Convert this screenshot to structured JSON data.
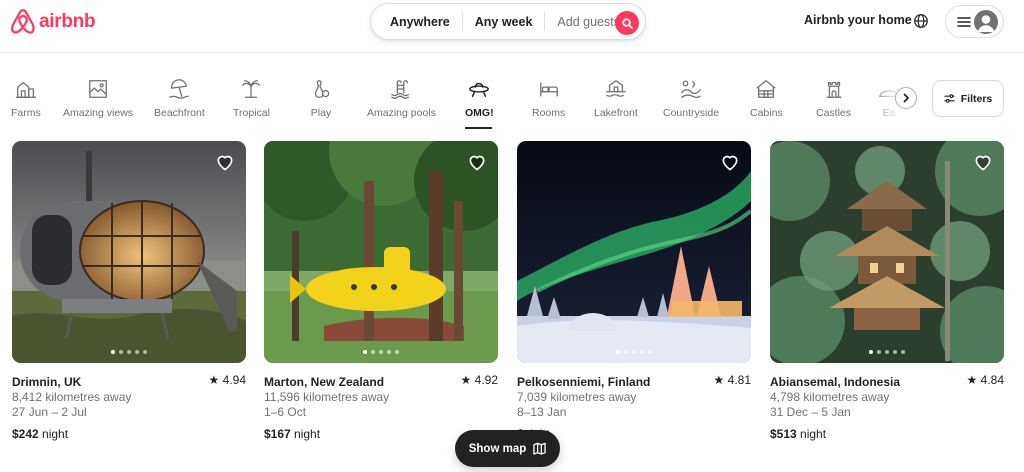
{
  "header": {
    "logo_text": "airbnb",
    "search": {
      "location": "Anywhere",
      "dates": "Any week",
      "guests": "Add guests"
    },
    "host_link": "Airbnb your home",
    "brand_color": "#ff385c"
  },
  "categories": {
    "active": "OMG!",
    "items": [
      {
        "label": "Farms",
        "icon": "barn-icon"
      },
      {
        "label": "Amazing views",
        "icon": "framed-landscape-icon"
      },
      {
        "label": "Beachfront",
        "icon": "beach-umbrella-icon"
      },
      {
        "label": "Tropical",
        "icon": "palm-tree-icon"
      },
      {
        "label": "Play",
        "icon": "bowling-pins-icon"
      },
      {
        "label": "Amazing pools",
        "icon": "pool-ladder-icon"
      },
      {
        "label": "OMG!",
        "icon": "ufo-icon"
      },
      {
        "label": "Rooms",
        "icon": "bed-icon"
      },
      {
        "label": "Lakefront",
        "icon": "lake-house-icon"
      },
      {
        "label": "Countryside",
        "icon": "hills-icon"
      },
      {
        "label": "Cabins",
        "icon": "cabin-icon"
      },
      {
        "label": "Castles",
        "icon": "castle-icon"
      },
      {
        "label": "Ea",
        "icon": "earth-home-icon"
      }
    ],
    "filters_label": "Filters"
  },
  "listings": [
    {
      "location": "Drimnin, UK",
      "rating": "4.94",
      "distance": "8,412 kilometres away",
      "dates": "27 Jun – 2 Jul",
      "price": "$242",
      "price_unit": " night",
      "photo": "glass-dome-pod"
    },
    {
      "location": "Marton, New Zealand",
      "rating": "4.92",
      "distance": "11,596 kilometres away",
      "dates": "1–6 Oct",
      "price": "$167",
      "price_unit": " night",
      "photo": "yellow-submarine-in-forest"
    },
    {
      "location": "Pelkosenniemi, Finland",
      "rating": "4.81",
      "distance": "7,039 kilometres away",
      "dates": "8–13 Jan",
      "price": "$",
      "price_unit": "night",
      "photo": "igloo-under-northern-lights"
    },
    {
      "location": "Abiansemal, Indonesia",
      "rating": "4.84",
      "distance": "4,798 kilometres away",
      "dates": "31 Dec – 5 Jan",
      "price": "$513",
      "price_unit": " night",
      "photo": "bamboo-treehouse-in-jungle"
    }
  ],
  "show_map_label": "Show map"
}
